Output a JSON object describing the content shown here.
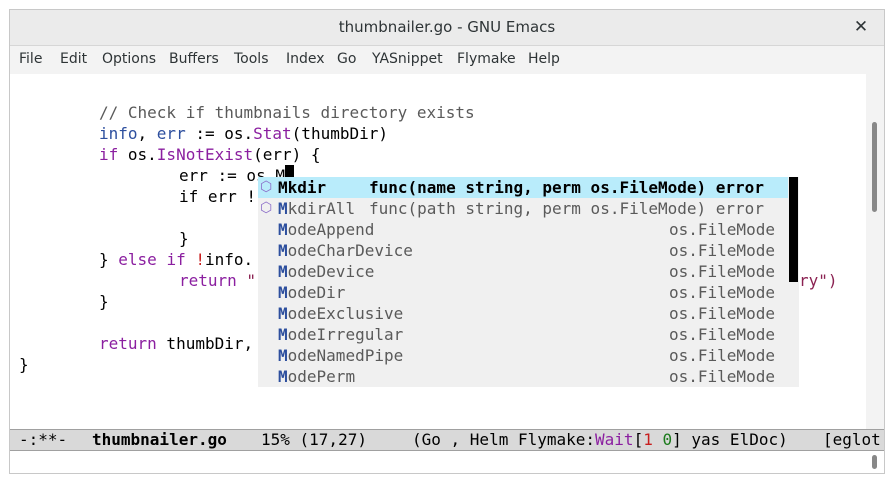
{
  "window": {
    "title": "thumbnailer.go - GNU Emacs",
    "close_glyph": "✕"
  },
  "menubar": {
    "items": [
      "File",
      "Edit",
      "Options",
      "Buffers",
      "Tools",
      "Index",
      "Go",
      "YASnippet",
      "Flymake",
      "Help"
    ]
  },
  "code": {
    "line1_comment": "// Check if thumbnails directory exists",
    "line2_info": "info",
    "line2_mid": ", ",
    "line2_err": "err",
    "line2_assign": " := os.",
    "line2_stat": "Stat",
    "line2_rest": "(thumbDir)",
    "line3_if": "if",
    "line3_mid": " os.",
    "line3_isnot": "IsNotExist",
    "line3_rest": "(err) {",
    "line4_text": "err := os.M",
    "line5_text": "if err !",
    "line6_text": "}",
    "line7_brace": "} ",
    "line7_else": "else",
    "line7_sp": " ",
    "line7_if": "if",
    "line7_bang": " !",
    "line7_info": "info.",
    "line8_return": "return",
    "line8_str": " \"",
    "line8_tail": "ry\")",
    "line9_text": "}",
    "line10_return": "return",
    "line10_rest": " thumbDir,",
    "line11_text": "}"
  },
  "completion": {
    "icon": "⬡",
    "items": [
      {
        "prefix": "M",
        "rest": "kdir",
        "signature": "func(name string, perm os.FileMode) error",
        "selected": true,
        "has_icon": true
      },
      {
        "prefix": "M",
        "rest": "kdirAll",
        "signature": "func(path string, perm os.FileMode) error",
        "selected": false,
        "has_icon": true
      },
      {
        "prefix": "M",
        "rest": "odeAppend",
        "type": "os.FileMode"
      },
      {
        "prefix": "M",
        "rest": "odeCharDevice",
        "type": "os.FileMode"
      },
      {
        "prefix": "M",
        "rest": "odeDevice",
        "type": "os.FileMode"
      },
      {
        "prefix": "M",
        "rest": "odeDir",
        "type": "os.FileMode"
      },
      {
        "prefix": "M",
        "rest": "odeExclusive",
        "type": "os.FileMode"
      },
      {
        "prefix": "M",
        "rest": "odeIrregular",
        "type": "os.FileMode"
      },
      {
        "prefix": "M",
        "rest": "odeNamedPipe",
        "type": "os.FileMode"
      },
      {
        "prefix": "M",
        "rest": "odePerm",
        "type": "os.FileMode"
      }
    ]
  },
  "modeline": {
    "status": "-:**-",
    "buffer_name": "thumbnailer.go",
    "position": "15% (17,27)",
    "modes_open": "(Go , Helm Flymake:",
    "flymake_wait": "Wait",
    "bracket_open": "[",
    "err_count": "1",
    "space": " ",
    "warn_count": "0",
    "bracket_close": "]",
    "modes_rest": " yas ElDoc)",
    "eglot": "[eglot"
  },
  "colors": {
    "selected_bg": "#b9ecfb",
    "popup_bg": "#f0f0f0",
    "keyword": "#8b1fa0",
    "variable": "#2d4f9e"
  }
}
